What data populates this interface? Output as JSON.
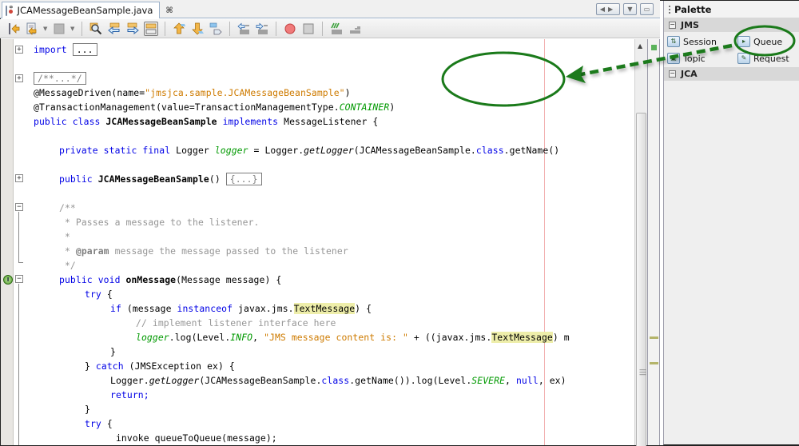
{
  "editor_tab": {
    "title": "JCAMessageBeanSample.java",
    "close_glyph": "⌘"
  },
  "tab_nav": {
    "left_right": "◀▶",
    "dropdown": "▼",
    "maximize": "▭"
  },
  "toolbar": {
    "buttons": [
      {
        "name": "last-edit-button",
        "icon": "last-edit-icon"
      },
      {
        "name": "back-button",
        "icon": "back-icon"
      },
      {
        "name": "forward-button",
        "icon": "forward-icon"
      },
      {
        "name": "find-selection-button",
        "icon": "find-icon"
      },
      {
        "name": "find-previous-button",
        "icon": "find-previous-icon"
      },
      {
        "name": "find-next-button",
        "icon": "find-next-icon"
      },
      {
        "name": "toggle-highlight-search-button",
        "icon": "highlight-icon"
      },
      {
        "name": "previous-bookmark-button",
        "icon": "previous-bookmark-icon"
      },
      {
        "name": "next-bookmark-button",
        "icon": "next-bookmark-icon"
      },
      {
        "name": "toggle-bookmark-button",
        "icon": "toggle-bookmark-icon"
      },
      {
        "name": "shift-left-button",
        "icon": "shift-left-icon"
      },
      {
        "name": "shift-right-button",
        "icon": "shift-right-icon"
      },
      {
        "name": "start-macro-button",
        "icon": "record-icon"
      },
      {
        "name": "stop-macro-button",
        "icon": "stop-icon"
      },
      {
        "name": "comment-button",
        "icon": "comment-icon"
      },
      {
        "name": "uncomment-button",
        "icon": "uncomment-icon"
      }
    ]
  },
  "code": {
    "import_kw": "import",
    "import_fold": "...",
    "doc_fold": "/**...*/",
    "l_anno1_a": "@MessageDriven(name=",
    "l_anno1_str": "\"jmsjca.sample.JCAMessageBeanSample\"",
    "l_anno1_b": ")",
    "l_anno2_a": "@TransactionManagement(value=TransactionManagementType.",
    "l_anno2_const": "CONTAINER",
    "l_anno2_b": ")",
    "l_class_kw": "public class ",
    "l_class_name": "JCAMessageBeanSample",
    "l_class_impl": " implements ",
    "l_class_rest": "MessageListener {",
    "l_logger_kw": "private static final ",
    "l_logger_type": "Logger ",
    "l_logger_field": "logger",
    "l_logger_eq": " = Logger.",
    "l_logger_method": "getLogger",
    "l_logger_args": "(JCAMessageBeanSample.",
    "l_logger_class": "class",
    "l_logger_end": ".getName()",
    "l_ctor_kw": "public ",
    "l_ctor_name": "JCAMessageBeanSample",
    "l_ctor_parens": "() ",
    "l_ctor_fold": "{...}",
    "doc_open": "/**",
    "doc_line1": " * Passes a message to the listener.",
    "doc_line2": " *",
    "doc_line3_star": " * ",
    "doc_line3_tag": "@param",
    "doc_line3_rest": " message the message passed to the listener",
    "doc_close": " */",
    "l_onmsg_kw": "public void ",
    "l_onmsg_name": "onMessage",
    "l_onmsg_rest": "(Message message) {",
    "l_try1": "try",
    "l_try1_rest": " {",
    "l_if_kw": "if",
    "l_if_a": " (message ",
    "l_if_inst": "instanceof",
    "l_if_b": " javax.jms.",
    "l_if_type": "TextMessage",
    "l_if_c": ") {",
    "l_comment": "// implement listener interface here",
    "l_log_field": "logger",
    "l_log_a": ".log(Level.",
    "l_log_const": "INFO",
    "l_log_b": ", ",
    "l_log_str": "\"JMS message content is: \"",
    "l_log_c": " + ((javax.jms.",
    "l_log_type": "TextMessage",
    "l_log_d": ") m",
    "l_close1": "}",
    "l_catch_a": "} ",
    "l_catch_kw": "catch",
    "l_catch_b": " (JMSException ex) {",
    "l_err_a": "Logger.",
    "l_err_method": "getLogger",
    "l_err_b": "(JCAMessageBeanSample.",
    "l_err_class": "class",
    "l_err_c": ".getName()).log(Level.",
    "l_err_const": "SEVERE",
    "l_err_d": ", ",
    "l_err_null": "null",
    "l_err_e": ", ex)",
    "l_return": "return;",
    "l_close2": "}",
    "l_try2": "try",
    "l_try2_rest": " {",
    "l_invoke": " invoke queueToQueue(message);",
    "impl_badge": "I"
  },
  "palette": {
    "title": "Palette",
    "categories": [
      {
        "label": "JMS",
        "toggle": "−",
        "items": [
          {
            "label": "Session",
            "icon": "session-icon",
            "glyph": "⇅"
          },
          {
            "label": "Queue",
            "icon": "queue-icon",
            "glyph": "▸"
          },
          {
            "label": "Topic",
            "icon": "topic-icon",
            "glyph": "▣"
          },
          {
            "label": "Request",
            "icon": "request-icon",
            "glyph": "✎"
          }
        ]
      },
      {
        "label": "JCA",
        "toggle": "−",
        "items": []
      }
    ]
  },
  "annotation": {
    "color": "#1a7a1a",
    "description": "drag Queue from Palette into editor"
  }
}
